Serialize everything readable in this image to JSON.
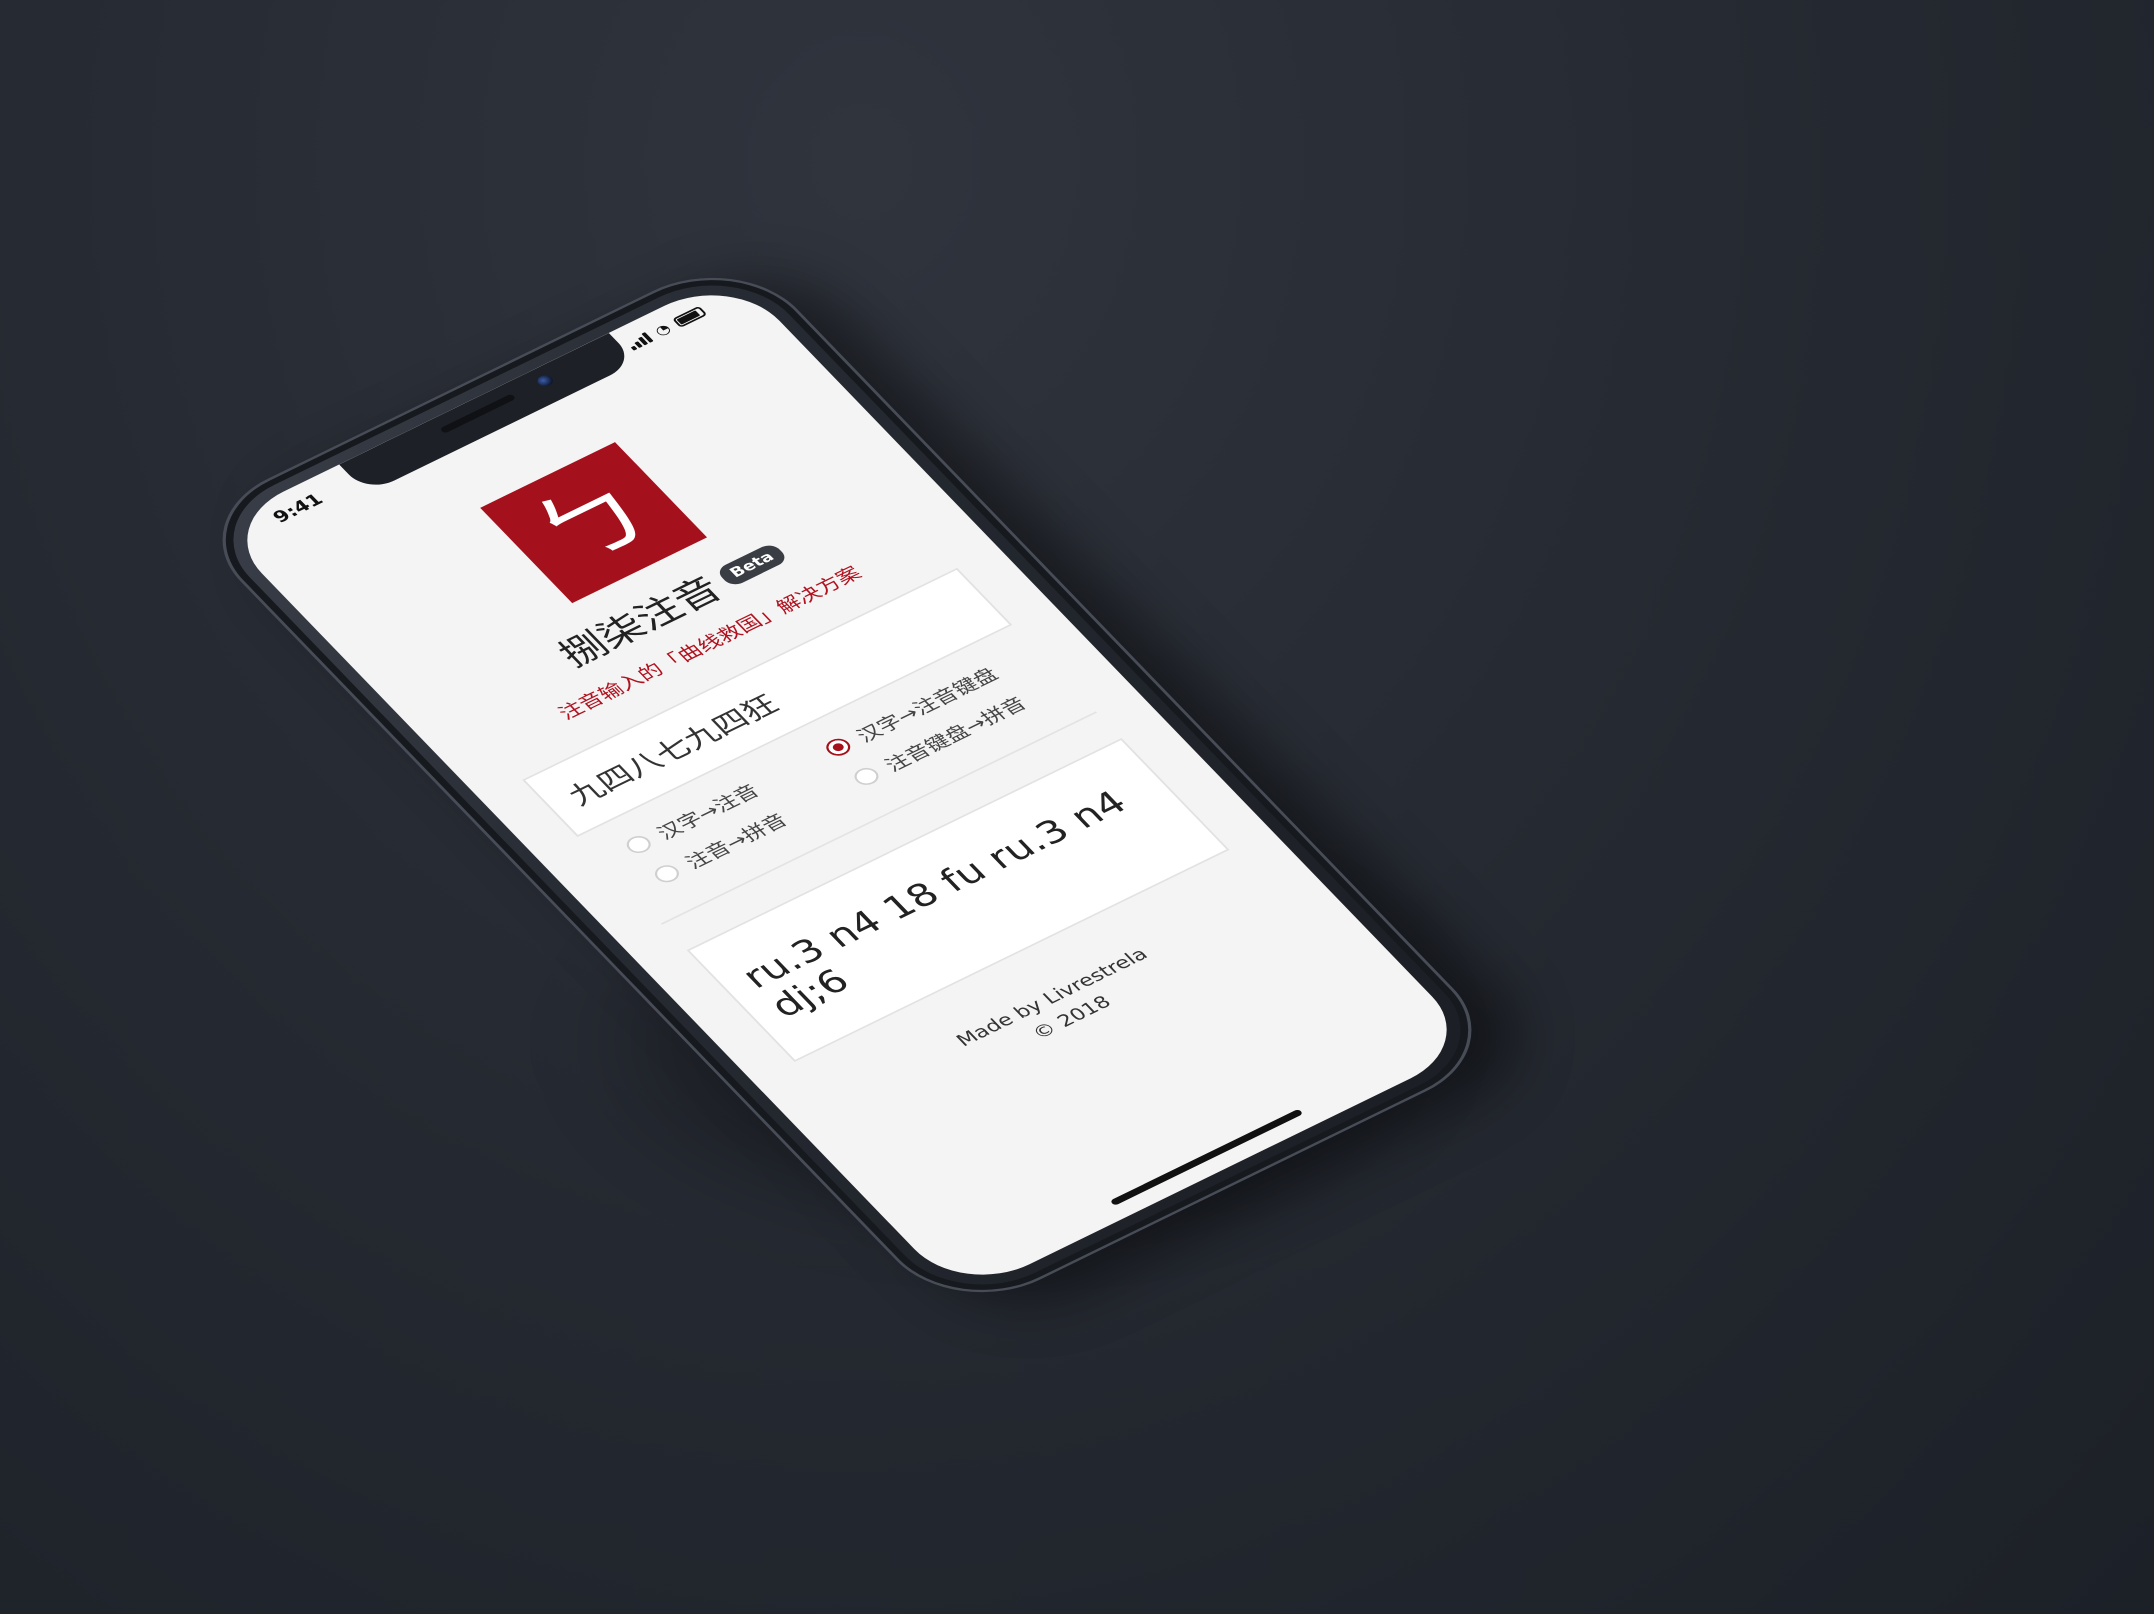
{
  "status": {
    "time": "9:41"
  },
  "logo": {
    "glyph": "ㄅ"
  },
  "app": {
    "title": "捌柒注音",
    "badge": "Beta",
    "subtitle": "注音输入的「曲线救国」解决方案"
  },
  "input": {
    "value": "九四八七九四狂"
  },
  "modes": [
    {
      "label": "汉字→注音",
      "checked": false
    },
    {
      "label": "汉字→注音键盘",
      "checked": true
    },
    {
      "label": "注音→拼音",
      "checked": false
    },
    {
      "label": "注音键盘→拼音",
      "checked": false
    }
  ],
  "output": {
    "value": "ru.3 n4 18 fu ru.3 n4 dj;6"
  },
  "footer": {
    "made_by": "Made by Livrestrela",
    "copyright": "© 2018"
  },
  "colors": {
    "accent": "#a5101d",
    "background": "#262a32",
    "screen": "#f4f4f4"
  },
  "icons": [
    "signal-icon",
    "wifi-icon",
    "battery-icon",
    "camera-icon",
    "speaker-icon"
  ]
}
